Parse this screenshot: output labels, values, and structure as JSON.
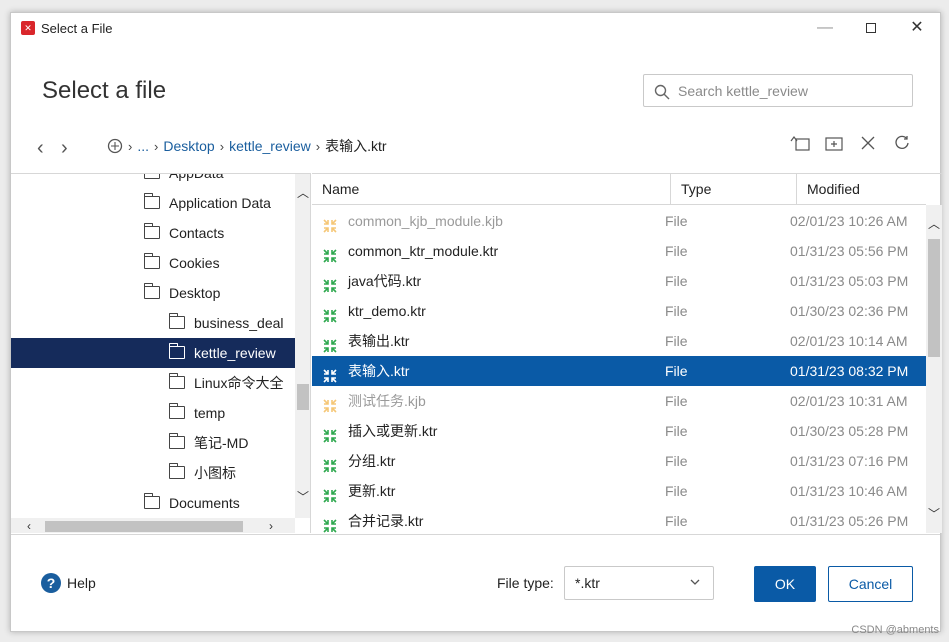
{
  "window": {
    "title": "Select a File"
  },
  "dialog": {
    "heading": "Select a file"
  },
  "search": {
    "placeholder": "Search kettle_review"
  },
  "breadcrumb": {
    "ellipsis": "...",
    "items": [
      "Desktop",
      "kettle_review"
    ],
    "current": "表输入.ktr"
  },
  "tree": {
    "items": [
      {
        "label": "AppData",
        "level": 1
      },
      {
        "label": "Application Data",
        "level": 1
      },
      {
        "label": "Contacts",
        "level": 1
      },
      {
        "label": "Cookies",
        "level": 1
      },
      {
        "label": "Desktop",
        "level": 1
      },
      {
        "label": "business_deal",
        "level": 2
      },
      {
        "label": "kettle_review",
        "level": 2,
        "selected": true
      },
      {
        "label": "Linux命令大全",
        "level": 2
      },
      {
        "label": "temp",
        "level": 2
      },
      {
        "label": "笔记-MD",
        "level": 2
      },
      {
        "label": "小图标",
        "level": 2
      },
      {
        "label": "Documents",
        "level": 1
      }
    ]
  },
  "files": {
    "columns": {
      "name": "Name",
      "type": "Type",
      "modified": "Modified"
    },
    "rows": [
      {
        "name": "common_kjb_module.kjb",
        "type": "File",
        "modified": "02/01/23 10:26 AM",
        "kind": "job",
        "dim": true
      },
      {
        "name": "common_ktr_module.ktr",
        "type": "File",
        "modified": "01/31/23 05:56 PM",
        "kind": "transformation"
      },
      {
        "name": "java代码.ktr",
        "type": "File",
        "modified": "01/31/23 05:03 PM",
        "kind": "transformation"
      },
      {
        "name": "ktr_demo.ktr",
        "type": "File",
        "modified": "01/30/23 02:36 PM",
        "kind": "transformation"
      },
      {
        "name": "表输出.ktr",
        "type": "File",
        "modified": "02/01/23 10:14 AM",
        "kind": "transformation"
      },
      {
        "name": "表输入.ktr",
        "type": "File",
        "modified": "01/31/23 08:32 PM",
        "kind": "transformation",
        "selected": true
      },
      {
        "name": "测试任务.kjb",
        "type": "File",
        "modified": "02/01/23 10:31 AM",
        "kind": "job",
        "dim": true
      },
      {
        "name": "插入或更新.ktr",
        "type": "File",
        "modified": "01/30/23 05:28 PM",
        "kind": "transformation"
      },
      {
        "name": "分组.ktr",
        "type": "File",
        "modified": "01/31/23 07:16 PM",
        "kind": "transformation"
      },
      {
        "name": "更新.ktr",
        "type": "File",
        "modified": "01/31/23 10:46 AM",
        "kind": "transformation"
      },
      {
        "name": "合并记录.ktr",
        "type": "File",
        "modified": "01/31/23 05:26 PM",
        "kind": "transformation"
      }
    ]
  },
  "footer": {
    "help_label": "Help",
    "filetype_label": "File type:",
    "filetype_value": "*.ktr",
    "ok_label": "OK",
    "cancel_label": "Cancel"
  },
  "watermark": "CSDN @abments",
  "colors": {
    "accent": "#0a5aa6",
    "tree_selected": "#152b5b",
    "ktr_icon": "#2fa84f",
    "kjb_icon": "#f0a21e",
    "app_icon": "#d9262b"
  }
}
